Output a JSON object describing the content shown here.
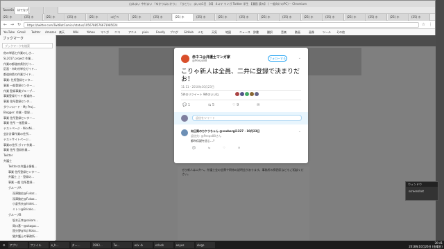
{
  "browser": {
    "window_title": "山本まい 中村まい 『ゆかりはいかり』 『ひとり』 まいの1日 【4】 4コマ マンガ Twitter 学生 【漫画 読み】 ( 一般向けのPC) -- Chromium",
    "tabs_row1": [
      "TweetDeck",
      "はてなブッ…",
      "",
      ""
    ],
    "tabs_row2": [
      "(25) ホ",
      "(25) ホ",
      "(25) ホ",
      "(25) ホ",
      "(25) ホ",
      "コピペ",
      "(25) ホ",
      "(25) ホ",
      "(25) ホ",
      "(25) ホ",
      "(25) ホ",
      "(25) ホ",
      "(25) ホ",
      "(25) ホ",
      "(25) ホ",
      "(25) ホ",
      "(25) ホ",
      "(25) ホ",
      "(25) ホ",
      "(25) ホ"
    ],
    "url": "https://twitter.com/TwitBotComics/status/1056788576671985024",
    "bookmarks": [
      "YouTube",
      "Gmail",
      "Twitter",
      "Amazon",
      "楽天",
      "Wiki",
      "Yahoo",
      "マンガ",
      "ニコ",
      "アニメ",
      "pixiv",
      "Feedly",
      "ブログ",
      "GitHub",
      "メモ",
      "天気",
      "地図",
      "ニュース",
      "辞書",
      "翻訳",
      "音楽",
      "動画",
      "画像",
      "ツール",
      "その他"
    ]
  },
  "sidebar": {
    "header": "ブックマーク",
    "search_placeholder": "ブックマークを検索",
    "items": [
      {
        "label": "他の単語と作業のしき…",
        "level": 1
      },
      {
        "label": "SL2017 project 作業…",
        "level": 1
      },
      {
        "label": "作業の都道府県別ガイ…",
        "level": 1
      },
      {
        "label": "区画・市町村単位ガイド…",
        "level": 1
      },
      {
        "label": "都道府県の作業ガイド…",
        "level": 1
      },
      {
        "label": "事業: 住所登録センタ…",
        "level": 1
      },
      {
        "label": "事業 一般登録センター…",
        "level": 1
      },
      {
        "label": "作業 登録事業グループ…",
        "level": 1
      },
      {
        "label": "事業登録ガイド 都道府…",
        "level": 1
      },
      {
        "label": "事業 住所登録センタ…",
        "level": 1
      },
      {
        "label": "ダウンロード - My Proj…",
        "level": 1
      },
      {
        "label": "Blogger: 作業 - 登録…",
        "level": 1
      },
      {
        "label": "事業 住所登録センター…",
        "level": 1
      },
      {
        "label": "事業 住所 一般登録…",
        "level": 1
      },
      {
        "label": "テストページ - NicoNi…",
        "level": 1
      },
      {
        "label": "会計計算作業の住所…",
        "level": 1
      },
      {
        "label": "テストサイトページ…",
        "level": 1
      },
      {
        "label": "事業の住所 ガイド作業…",
        "level": 1
      },
      {
        "label": "事業 住所 登録作業…",
        "level": 1
      },
      {
        "label": "Twitter",
        "level": 1
      },
      {
        "label": "弁護士",
        "level": 1
      },
      {
        "label": "Twitterの弁護士情報…",
        "level": 2
      },
      {
        "label": "事業 住所登録センター…",
        "level": 2
      },
      {
        "label": "弁護士 上 - 登録の…",
        "level": 2
      },
      {
        "label": "事業 一般 住所登録…",
        "level": 2
      },
      {
        "label": "グループA",
        "level": 2
      },
      {
        "label": "深澤諭史@Fukaz…",
        "level": 3
      },
      {
        "label": "深澤諭史@Fukaz…",
        "level": 3
      },
      {
        "label": "小倉秀夫@hidek…",
        "level": 3
      },
      {
        "label": "ミトン@Bricolo…",
        "level": 3
      },
      {
        "label": "グループB",
        "level": 2
      },
      {
        "label": "坂本正幸@sakam…",
        "level": 3
      },
      {
        "label": "岡口基一@okaguc…",
        "level": 3
      },
      {
        "label": "国分野@Yuji Koku…",
        "level": 3
      },
      {
        "label": "猫弁護士の事務所…",
        "level": 3
      }
    ]
  },
  "tweet": {
    "author_name": "赤ネコ@弁護士マンガ家",
    "author_handle": "@Peepo88",
    "follow_label": "フォローする",
    "text": "こりゃ新人は全員、二弁に登録で決まりだお！",
    "timestamp": "11:11 - 2018年10月23日",
    "stats": "5件のリツイート  9件のいいね",
    "actions": {
      "reply": "1",
      "retweet": "5",
      "like": "9"
    },
    "reply_placeholder": "返信をツイート",
    "reply": {
      "name": "向日葵のカケラちゃん @xxxbergi1327 · 10月23日",
      "to": "返信先: @Peepo88さん",
      "text": "都市伝説を信じ…？"
    }
  },
  "timeline_text": "ぜひ新人は二弁へ。弁護士会の会費や研修の説明会があります。事務所の雰囲気などもご相談ください。",
  "popup": {
    "title": "ウィンドウ",
    "body": "screenshot"
  },
  "taskbar": {
    "items": [
      "アプリ",
      "ファイル",
      "e_h…",
      "ター…",
      "1993…",
      "Tw…",
      "w/x -b",
      "xclock",
      "eeyes",
      "xlogo"
    ],
    "time": "20:41",
    "date": "2018年10月26日 (金曜日)"
  }
}
